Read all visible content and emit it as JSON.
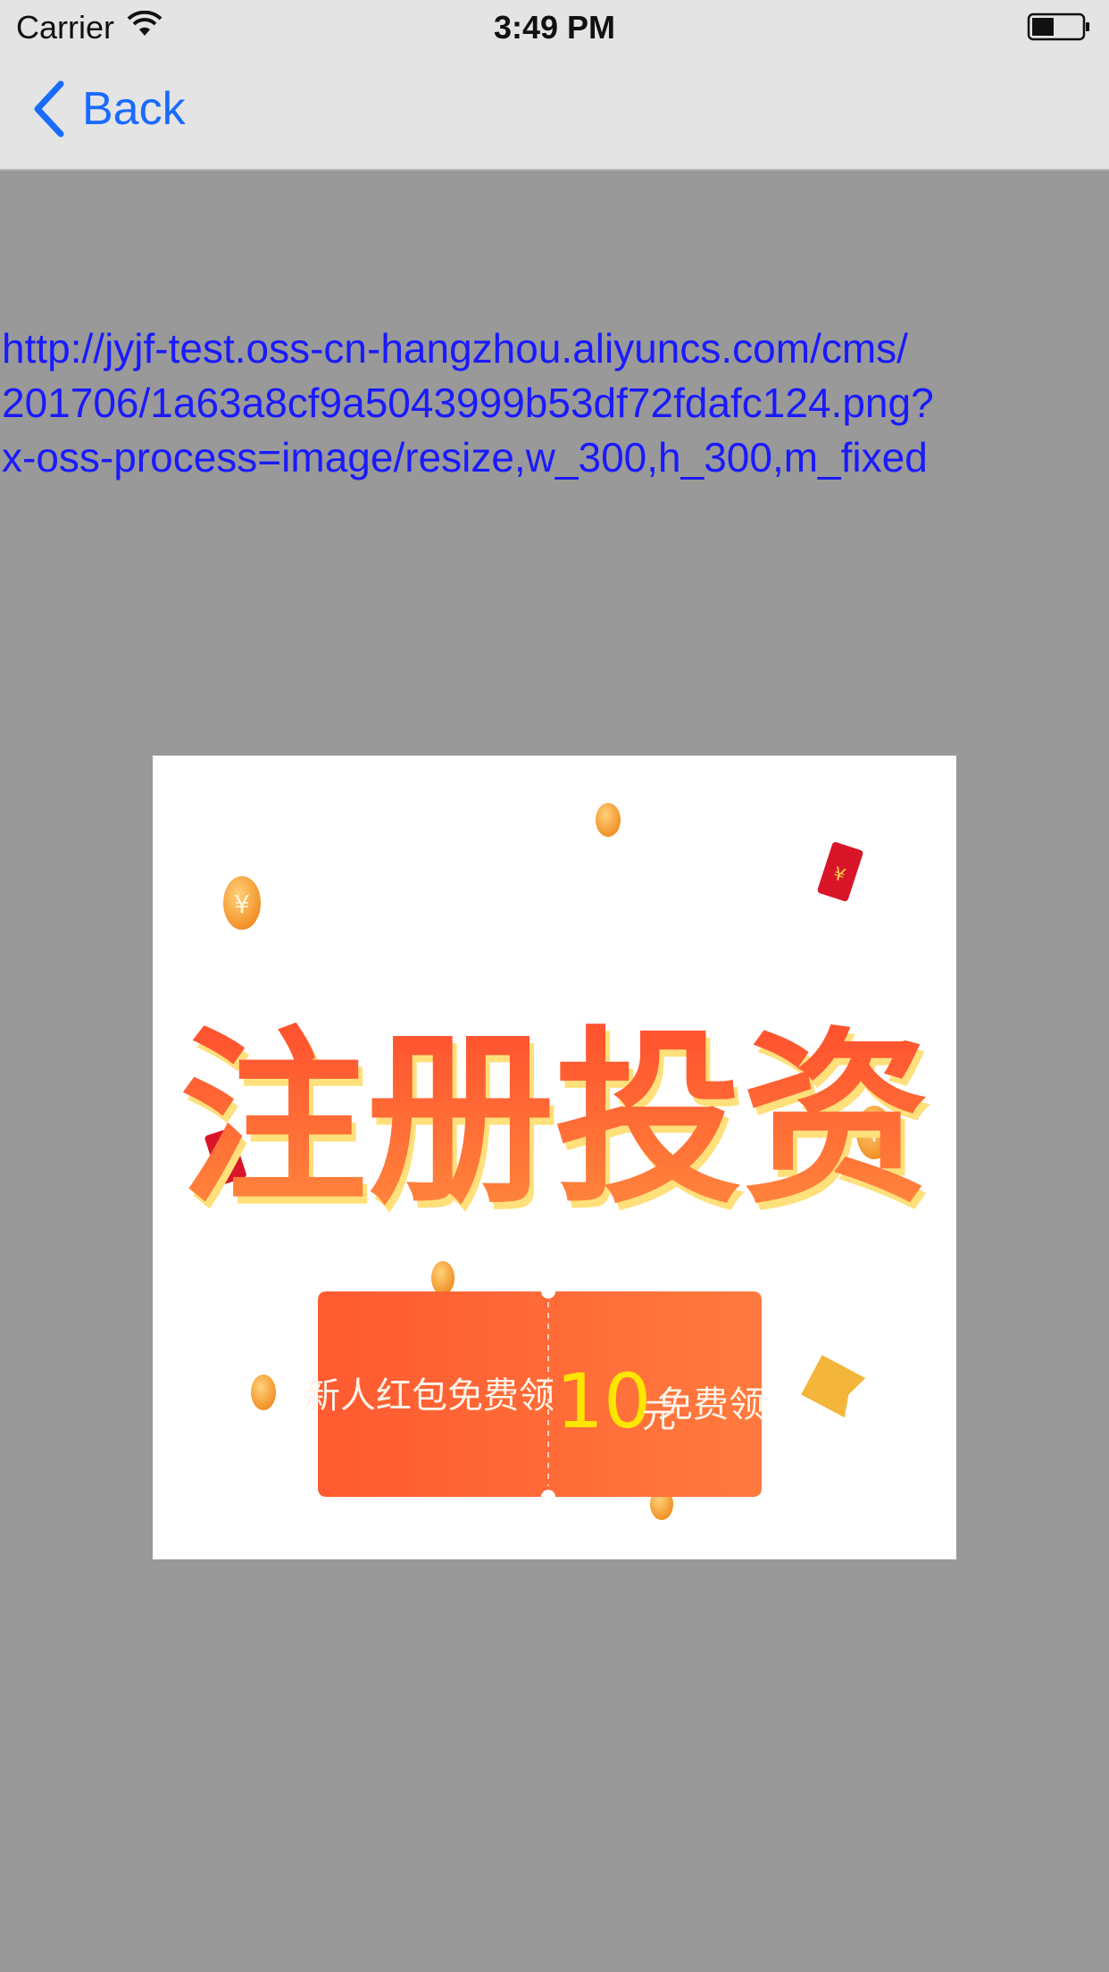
{
  "status_bar": {
    "carrier": "Carrier",
    "time": "3:49 PM"
  },
  "nav": {
    "back_label": "Back"
  },
  "content": {
    "url_text": "http://jyjf-test.oss-cn-hangzhou.aliyuncs.com/cms/\n201706/1a63a8cf9a5043999b53df72fdafc124.png?\nx-oss-process=image/resize,w_300,h_300,m_fixed"
  },
  "banner": {
    "headline": "注册投资",
    "ticket_left": "新人红包免费领",
    "ticket_amount": "10",
    "ticket_unit": "元",
    "ticket_right": "免费领",
    "coupon_badge": "¥",
    "colors": {
      "headline": "#ff5a2a",
      "ticket": "#ff6a3a",
      "amount": "#ffe600",
      "coin": "#f7a534",
      "red_packet": "#d9152a"
    }
  }
}
